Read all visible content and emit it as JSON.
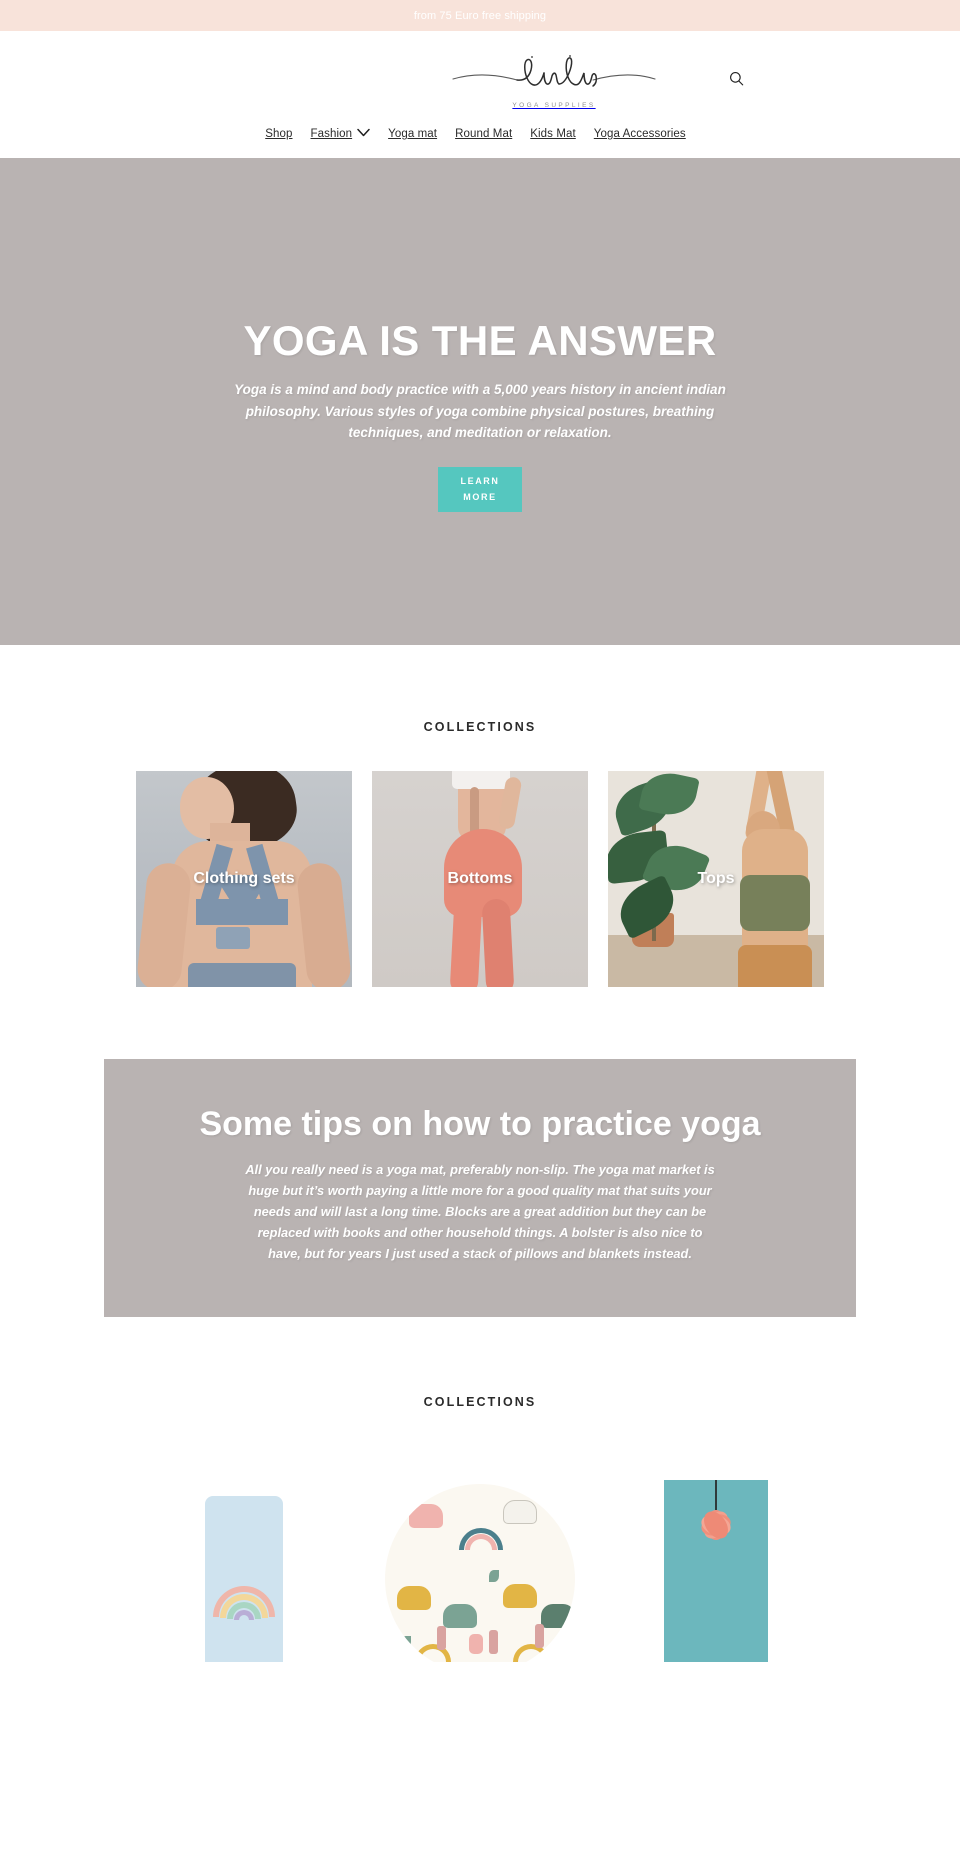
{
  "announcement": {
    "text": "from 75 Euro free shipping",
    "background": "#f8e3da",
    "text_color": "#ffffff"
  },
  "header": {
    "logo_text": "linlin",
    "logo_subtitle": "YOGA SUPPLIES",
    "search_icon": "search-icon",
    "nav": [
      {
        "label": "Shop",
        "has_dropdown": false
      },
      {
        "label": "Fashion",
        "has_dropdown": true
      },
      {
        "label": "Yoga mat",
        "has_dropdown": false
      },
      {
        "label": "Round Mat",
        "has_dropdown": false
      },
      {
        "label": "Kids Mat",
        "has_dropdown": false
      },
      {
        "label": "Yoga Accessories",
        "has_dropdown": false
      }
    ]
  },
  "hero": {
    "title": "YOGA IS THE ANSWER",
    "subtitle": "Yoga is a mind and body practice with a 5,000 years history in ancient indian philosophy. Various styles of yoga combine physical postures, breathing techniques, and meditation or relaxation.",
    "button_label": "LEARN MORE",
    "button_color": "#55c7bf",
    "background": "#b9b3b2"
  },
  "collections_apparel": {
    "heading": "COLLECTIONS",
    "cards": [
      {
        "label": "Clothing sets"
      },
      {
        "label": "Bottoms"
      },
      {
        "label": "Tops"
      }
    ]
  },
  "tips": {
    "title": "Some tips on how to practice yoga",
    "body": "All you really need is a yoga mat, preferably non-slip. The yoga mat market is huge but it’s worth paying a little more for a good quality mat that suits your needs and will last a long time. Blocks are a great addition but they can be replaced with books and other household things. A bolster is also nice to have, but for years I just used a stack of pillows and blankets instead.",
    "background": "#b9b3b2"
  },
  "collections_mats": {
    "heading": "COLLECTIONS",
    "cards": [
      {
        "label": ""
      },
      {
        "label": ""
      },
      {
        "label": ""
      }
    ]
  }
}
